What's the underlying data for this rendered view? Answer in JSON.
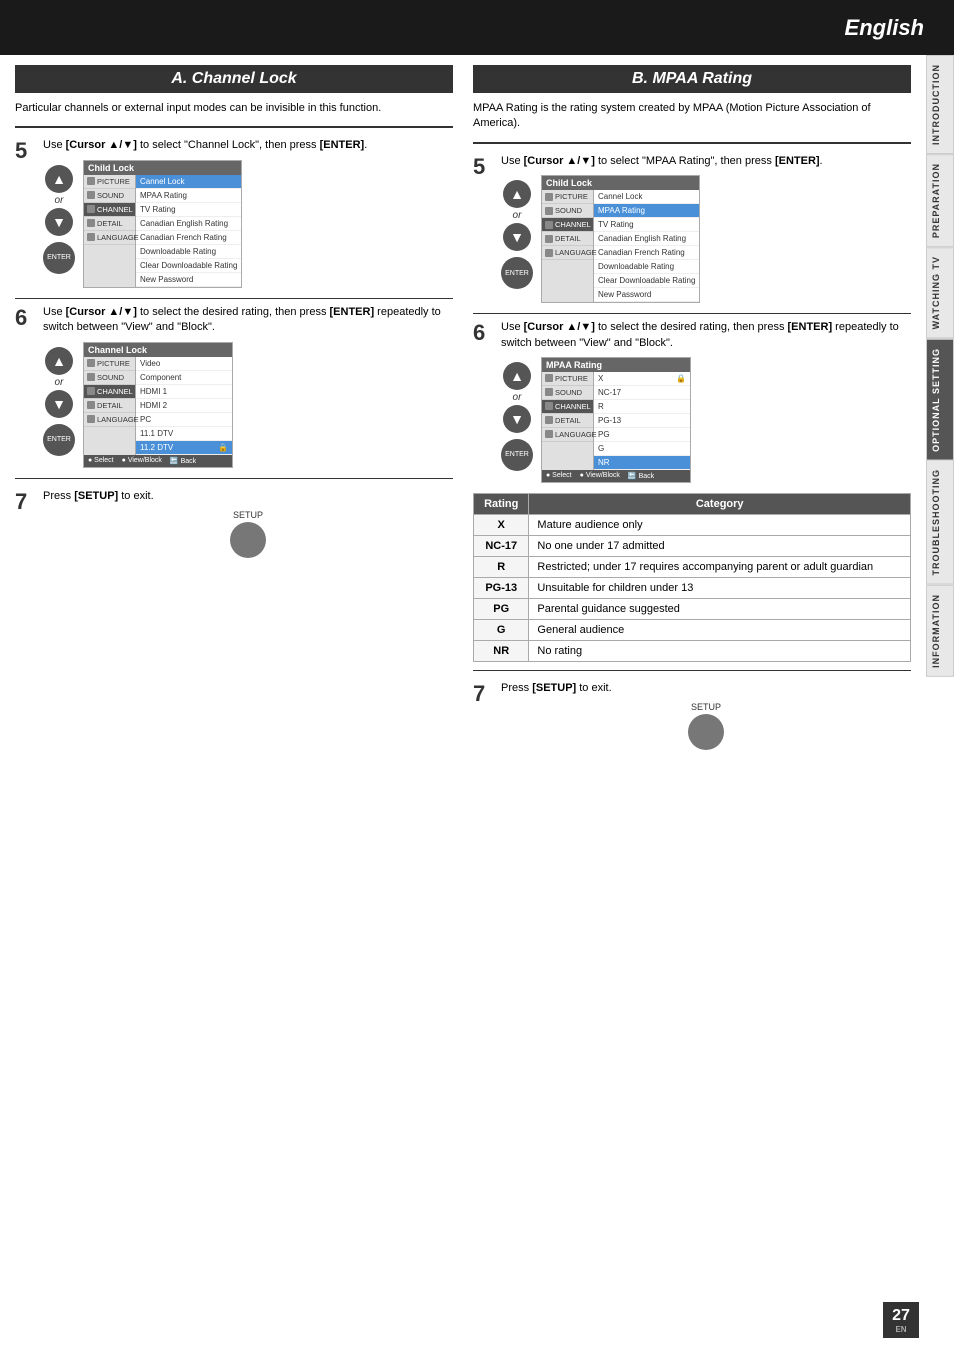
{
  "header": {
    "english_label": "English",
    "background": "#1a1a1a"
  },
  "side_tabs": [
    {
      "label": "INTRODUCTION",
      "active": false
    },
    {
      "label": "PREPARATION",
      "active": false
    },
    {
      "label": "WATCHING TV",
      "active": false
    },
    {
      "label": "OPTIONAL SETTING",
      "active": true
    },
    {
      "label": "TROUBLESHOOTING",
      "active": false
    },
    {
      "label": "INFORMATION",
      "active": false
    }
  ],
  "section_a": {
    "title": "A.  Channel Lock",
    "description": "Particular channels or external input modes can be invisible in this function.",
    "step5": {
      "number": "5",
      "text_pre": "Use ",
      "text_bold": "[Cursor ▲/▼]",
      "text_post": " to select \"Channel Lock\", then press ",
      "text_bold2": "[ENTER]",
      "text_end": ".",
      "menu_title": "Child Lock",
      "menu_items": [
        "Cannel Lock",
        "MPAA Rating",
        "TV Rating",
        "Canadian English Rating",
        "Canadian French Rating",
        "Downloadable Rating",
        "Clear Downloadable Rating",
        "New Password"
      ],
      "highlighted": "Cannel Lock"
    },
    "step6": {
      "number": "6",
      "text_pre": "Use ",
      "text_bold": "[Cursor ▲/▼]",
      "text_post": " to select the desired rating, then press ",
      "text_bold2": "[ENTER]",
      "text_post2": " repeatedly to switch between \"View\" and \"Block\".",
      "menu_title": "Channel Lock",
      "menu_items": [
        "Video",
        "Component",
        "HDMI 1",
        "HDMI 2",
        "PC",
        "11.1 DTV",
        "11.2 DTV"
      ],
      "highlighted": "11.2 DTV"
    },
    "step7": {
      "number": "7",
      "text_pre": "Press ",
      "text_bold": "[SETUP]",
      "text_post": " to exit.",
      "setup_label": "SETUP"
    }
  },
  "section_b": {
    "title": "B.  MPAA Rating",
    "description": "MPAA Rating is the rating system created by MPAA (Motion Picture Association of America).",
    "step5": {
      "number": "5",
      "text_pre": "Use ",
      "text_bold": "[Cursor ▲/▼]",
      "text_post": " to select \"MPAA Rating\", then press ",
      "text_bold2": "[ENTER]",
      "text_end": ".",
      "menu_title": "Child Lock",
      "menu_items": [
        "Cannel Lock",
        "MPAA Rating",
        "TV Rating",
        "Canadian English Rating",
        "Canadian French Rating",
        "Downloadable Rating",
        "Clear Downloadable Rating",
        "New Password"
      ],
      "highlighted": "MPAA Rating"
    },
    "step6": {
      "number": "6",
      "text_pre": "Use ",
      "text_bold": "[Cursor ▲/▼]",
      "text_post": " to select the desired rating, then press ",
      "text_bold2": "[ENTER]",
      "text_post2": " repeatedly to switch between \"View\" and \"Block\".",
      "menu_title": "MPAA Rating",
      "menu_items": [
        "X",
        "NC-17",
        "R",
        "PG-13",
        "PG",
        "G",
        "NR"
      ],
      "highlighted": "NR"
    },
    "rating_table": {
      "headers": [
        "Rating",
        "Category"
      ],
      "rows": [
        {
          "rating": "X",
          "category": "Mature audience only"
        },
        {
          "rating": "NC-17",
          "category": "No one under 17 admitted"
        },
        {
          "rating": "R",
          "category": "Restricted; under 17 requires accompanying parent or adult guardian"
        },
        {
          "rating": "PG-13",
          "category": "Unsuitable for children under 13"
        },
        {
          "rating": "PG",
          "category": "Parental guidance suggested"
        },
        {
          "rating": "G",
          "category": "General audience"
        },
        {
          "rating": "NR",
          "category": "No rating"
        }
      ]
    },
    "step7": {
      "number": "7",
      "text_pre": "Press ",
      "text_bold": "[SETUP]",
      "text_post": " to exit.",
      "setup_label": "SETUP"
    }
  },
  "page_number": "27",
  "page_number_sub": "EN",
  "menu_left_items": [
    "PICTURE",
    "SOUND",
    "CHANNEL",
    "DETAIL",
    "LANGUAGE"
  ]
}
